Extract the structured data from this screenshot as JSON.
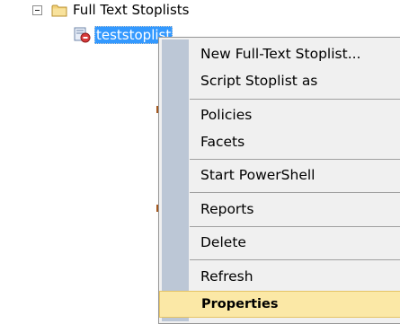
{
  "tree": {
    "folder_label": "Full Text Stoplists",
    "selected_item_label": "teststoplist"
  },
  "context_menu": {
    "items": [
      {
        "label": "New Full-Text Stoplist..."
      },
      {
        "label": "Script Stoplist as"
      },
      {
        "label": "Policies"
      },
      {
        "label": "Facets"
      },
      {
        "label": "Start PowerShell"
      },
      {
        "label": "Reports"
      },
      {
        "label": "Delete"
      },
      {
        "label": "Refresh"
      },
      {
        "label": "Properties"
      }
    ],
    "highlighted_item": "Properties"
  },
  "colors": {
    "selection": "#3399ff",
    "menu_background": "#f0f0f0",
    "menu_gutter": "#bcc7d6",
    "highlight": "#fbe8a6"
  }
}
